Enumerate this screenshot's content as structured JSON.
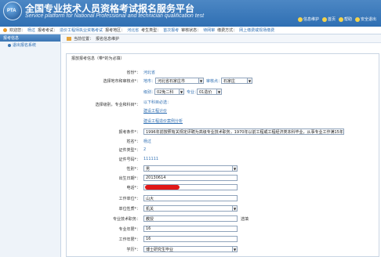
{
  "header": {
    "logo_text": "PTA",
    "title": "全国专业技术人员资格考试报名服务平台",
    "subtitle": "Service platform for National Professional and technician qualification test",
    "links": [
      {
        "label": "信息维护"
      },
      {
        "label": "首页"
      },
      {
        "label": "帮助"
      },
      {
        "label": "安全退出"
      }
    ]
  },
  "infobar": {
    "welcome_key": "欢迎您：",
    "welcome_val": "杨过",
    "exam_key": "报考考试：",
    "exam_val": "造价工程师执业资格考试",
    "area_key": "报考地区：",
    "area_val": "河北省",
    "type_key": "考生类型：",
    "type_val": "首次报考",
    "status_key": "审核状态：",
    "status_val": "待网审",
    "fee_key": "缴费方式：",
    "fee_val": "网上缴费或现场缴费"
  },
  "sidebar": {
    "head": "报考信息",
    "items": [
      {
        "label": "退出报名系统"
      }
    ]
  },
  "breadcrumb": {
    "label": "当前位置：",
    "path": "报名信息维护"
  },
  "panel": {
    "title": "报放报考信息（带*的为必填）",
    "province_label": "省份*：",
    "province_val": "河北省",
    "city_label": "选择地市和审核点*：",
    "city_prefix": "地市：",
    "city_val": "河北省石家庄市",
    "audit_prefix": "审核点：",
    "audit_val": "石家庄",
    "level_label": "选择级别，专业和科目*：",
    "level_prefix": "级别：",
    "level_val": "02免二科",
    "major_prefix": "专业：",
    "major_val": "01造价",
    "subject_hint": "以下科目必选：",
    "subjects": [
      "建设工程计价",
      "建设工程造价案例分析"
    ],
    "cond_label": "报考条件*：",
    "cond_val": "1996年前按照有关规定评聘为高级专业技术职务，1970年以前工程或工程经济类本科毕业，从事专业工作满15年",
    "name_label": "姓名*：",
    "name_val": "杨过",
    "idtype_label": "证件类型*：",
    "idtype_val": "2",
    "idno_label": "证件号码*：",
    "idno_val": "111111",
    "photo_label": "证件号码*：",
    "gender_label": "性别*：",
    "gender_val": "男",
    "birth_label": "出生日期*：",
    "birth_val": "20130614",
    "phone_label": "电话*：",
    "employer_label": "工作单位*：",
    "employer_val": "山大",
    "unitnature_label": "单位性质*：",
    "unitnature_val": "机关",
    "title_label": "专业技术职务：",
    "title_val": "教授",
    "title_opt": "选填",
    "workyears_label": "专业年限*：",
    "workyears_val": "16",
    "workyears2_label": "工作年限*：",
    "workyears2_val": "16",
    "edu_label": "学历*：",
    "edu_val": "博士研究生毕业"
  },
  "colors": {
    "header": "#2f6fb3",
    "link": "#2f6fb3",
    "redaction": "#e01818"
  }
}
